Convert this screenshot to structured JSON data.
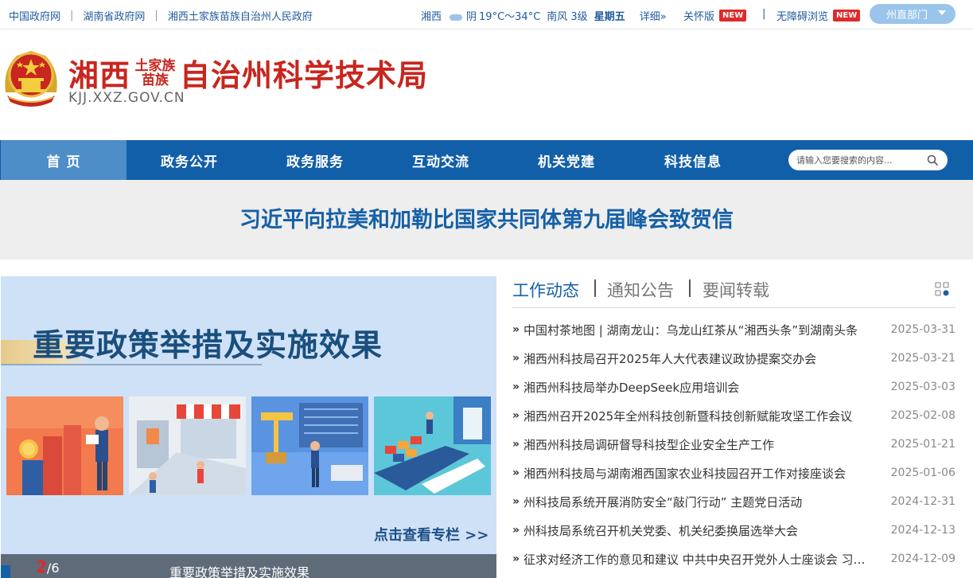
{
  "top_links": [
    "中国政府网",
    "湖南省政府网",
    "湘西土家族苗族自治州人民政府"
  ],
  "weather": {
    "city": "湘西",
    "condition": "阴",
    "temp": "19°C～34°C",
    "wind": "南风 3级",
    "weekday": "星期五",
    "details": "详细»"
  },
  "modes": {
    "care": "关怀版",
    "accessible": "无障碍浏览",
    "new_badge": "NEW"
  },
  "dept_select": "州直部门",
  "site": {
    "title_left": "湘西",
    "title_small": "土家族苗族",
    "title_right": "自治州科学技术局",
    "domain": "KJJ.XXZ.GOV.CN"
  },
  "nav": [
    "首 页",
    "政务公开",
    "政务服务",
    "互动交流",
    "机关党建",
    "科技信息"
  ],
  "search": {
    "placeholder": "请输入您要搜索的内容..."
  },
  "headline": "习近平向拉美和加勒比国家共同体第九届峰会致贺信",
  "banner": {
    "title": "重要政策举措及实施效果",
    "more": "点击查看专栏 >>",
    "caption": "重要政策举措及实施效果",
    "page_current": "2",
    "page_total": "/6"
  },
  "news_tabs": [
    "工作动态",
    "通知公告",
    "要闻转载"
  ],
  "news": [
    {
      "title": "中国村茶地图 | 湖南龙山：乌龙山红茶从“湘西头条”到湖南头条",
      "date": "2025-03-31"
    },
    {
      "title": "湘西州科技局召开2025年人大代表建议政协提案交办会",
      "date": "2025-03-21"
    },
    {
      "title": "湘西州科技局举办DeepSeek应用培训会",
      "date": "2025-03-03"
    },
    {
      "title": "湘西州召开2025年全州科技创新暨科技创新赋能攻坚工作会议",
      "date": "2025-02-08"
    },
    {
      "title": "湘西州科技局调研督导科技型企业安全生产工作",
      "date": "2025-01-21"
    },
    {
      "title": "湘西州科技局与湖南湘西国家农业科技园召开工作对接座谈会",
      "date": "2025-01-06"
    },
    {
      "title": "州科技局系统开展消防安全“敲门行动” 主题党日活动",
      "date": "2024-12-31"
    },
    {
      "title": "州科技局系统召开机关党委、机关纪委换届选举大会",
      "date": "2024-12-13"
    },
    {
      "title": "征求对经济工作的意见和建议 中共中央召开党外人士座谈会 习近平主持并发表重要讲话",
      "date": "2024-12-09"
    }
  ]
}
